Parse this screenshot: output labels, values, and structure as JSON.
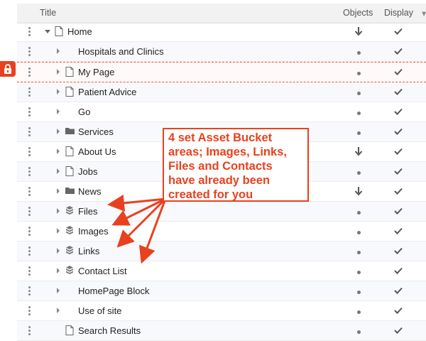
{
  "header": {
    "title": "Title",
    "objects": "Objects",
    "display": "Display"
  },
  "rows": [
    {
      "label": "Home",
      "icon": "page-icon",
      "caret": "down",
      "objects": "arrow-down"
    },
    {
      "label": "Hospitals and Clinics",
      "icon": "none",
      "caret": "right",
      "objects": "dot"
    },
    {
      "label": "My Page",
      "icon": "page-icon",
      "caret": "right",
      "objects": "dot",
      "locked": true
    },
    {
      "label": "Patient Advice",
      "icon": "page-icon",
      "caret": "right",
      "objects": "dot"
    },
    {
      "label": "Go",
      "icon": "none",
      "caret": "right",
      "objects": "dot"
    },
    {
      "label": "Services",
      "icon": "folder-icon",
      "caret": "right",
      "objects": "dot"
    },
    {
      "label": "About Us",
      "icon": "page-icon",
      "caret": "right",
      "objects": "arrow-down"
    },
    {
      "label": "Jobs",
      "icon": "page-icon",
      "caret": "right",
      "objects": "dot"
    },
    {
      "label": "News",
      "icon": "folder-icon",
      "caret": "right",
      "objects": "arrow-down"
    },
    {
      "label": "Files",
      "icon": "bucket-icon",
      "caret": "right",
      "objects": "dot"
    },
    {
      "label": "Images",
      "icon": "bucket-icon",
      "caret": "right",
      "objects": "dot"
    },
    {
      "label": "Links",
      "icon": "bucket-icon",
      "caret": "right",
      "objects": "dot"
    },
    {
      "label": "Contact List",
      "icon": "bucket-icon",
      "caret": "right",
      "objects": "dot"
    },
    {
      "label": "HomePage Block",
      "icon": "none",
      "caret": "right",
      "objects": "dot"
    },
    {
      "label": "Use of site",
      "icon": "none",
      "caret": "right",
      "objects": "dot"
    },
    {
      "label": "Search Results",
      "icon": "page-icon",
      "caret": "none",
      "objects": "dot"
    }
  ],
  "callout": {
    "lines": [
      "4 set Asset Bucket",
      "areas; Images, Links,",
      "Files and Contacts",
      "have already been",
      "created for you"
    ],
    "color": "#e8411f"
  },
  "colors": {
    "accent": "#e8411f",
    "header_bg": "#f2f2f2",
    "alt_row": "#f7f9fc"
  }
}
